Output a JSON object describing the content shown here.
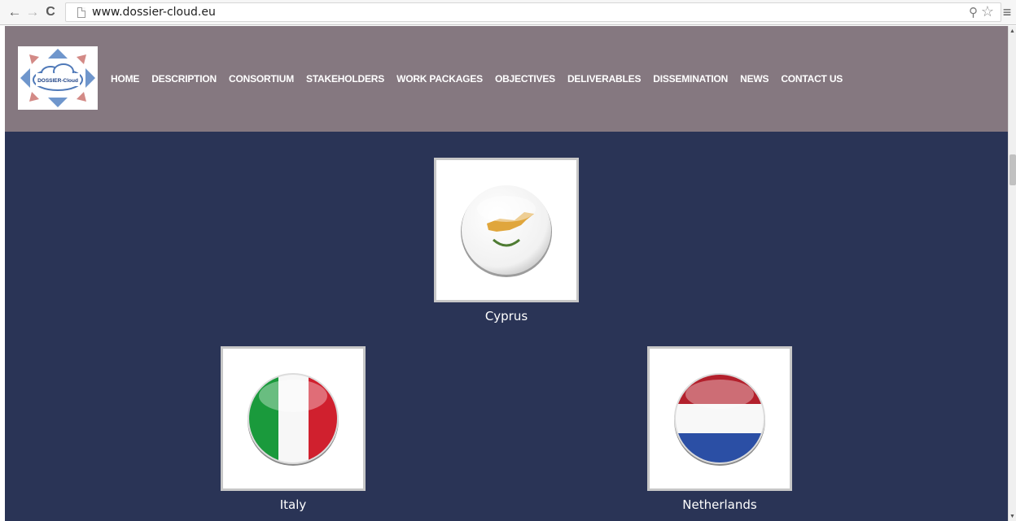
{
  "browser": {
    "back_icon": "arrow-left-icon",
    "forward_icon": "arrow-right-icon",
    "reload_icon": "reload-icon",
    "url": "www.dossier-cloud.eu",
    "zoom_icon": "magnifier-icon",
    "bookmark_icon": "star-icon",
    "menu_icon": "hamburger-menu-icon"
  },
  "site": {
    "logo_text": "DOSSIER-Cloud",
    "nav": [
      "HOME",
      "DESCRIPTION",
      "CONSORTIUM",
      "STAKEHOLDERS",
      "WORK PACKAGES",
      "OBJECTIVES",
      "DELIVERABLES",
      "DISSEMINATION",
      "NEWS",
      "CONTACT US"
    ],
    "colors": {
      "header_bg": "#857880",
      "content_bg": "#2a3456",
      "nav_text": "#ffffff"
    }
  },
  "countries": [
    {
      "name": "Cyprus",
      "flag_icon": "cyprus-flag-icon"
    },
    {
      "name": "Italy",
      "flag_icon": "italy-flag-icon"
    },
    {
      "name": "Netherlands",
      "flag_icon": "netherlands-flag-icon"
    }
  ]
}
